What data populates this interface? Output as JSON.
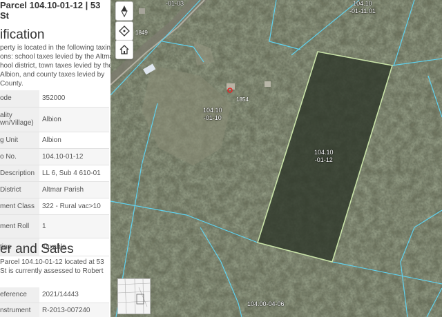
{
  "panel": {
    "title_line1": "Parcel 104.10-01-12 | 53",
    "title_line2": "St",
    "section1_heading": "ification",
    "section1_text": [
      "perty is located in the following taxing",
      "ons: school taxes levied by the Altmar",
      "hool district, town taxes levied by the",
      "Albion, and county taxes levied by",
      "County."
    ],
    "rows": [
      {
        "label": "ode",
        "label2": "",
        "value": "352000"
      },
      {
        "label": "ality",
        "label2": "wn/Village)",
        "value": "Albion"
      },
      {
        "label": "g Unit",
        "label2": "",
        "value": "Albion"
      },
      {
        "label": "o No.",
        "label2": "",
        "value": "104.10-01-12"
      },
      {
        "label": " Description",
        "label2": "",
        "value": "LL 6, Sub 4 610-01"
      },
      {
        "label": "District",
        "label2": "",
        "value": "Altmar Parish"
      },
      {
        "label": "ment Class",
        "label2": "",
        "value": "322 - Rural vac>10"
      },
      {
        "label": "ment Roll",
        "label2": "",
        "value": "1"
      },
      {
        "label": "tion",
        "label2": "",
        "value": "Taxable"
      }
    ],
    "section2_heading": "er and Sales",
    "section2_text": [
      "Parcel 104.10-01-12 located at 53",
      "St is currently assessed to Robert"
    ],
    "rows2": [
      {
        "label": "eference",
        "value": "2021/14443"
      },
      {
        "label": "nstrument",
        "value": "R-2013-007240"
      }
    ]
  },
  "map": {
    "controls": [
      "compass-icon",
      "locate-icon",
      "home-icon"
    ],
    "parcel_labels": [
      {
        "line1": "104.10",
        "line2": "-01-10"
      },
      {
        "line1": "104.10",
        "line2": "-01-12"
      },
      {
        "line1": "104.10",
        "line2": "-01-11.01"
      },
      {
        "line1": "-01-03",
        "line2": ""
      },
      {
        "line1": "104.00-04-06",
        "line2": ""
      }
    ],
    "address_labels": [
      "1849",
      "1854"
    ],
    "selected_outline_color": "#c9e3a8",
    "parcel_line_color": "#5fd3f0",
    "marker_color": "#e02424"
  }
}
